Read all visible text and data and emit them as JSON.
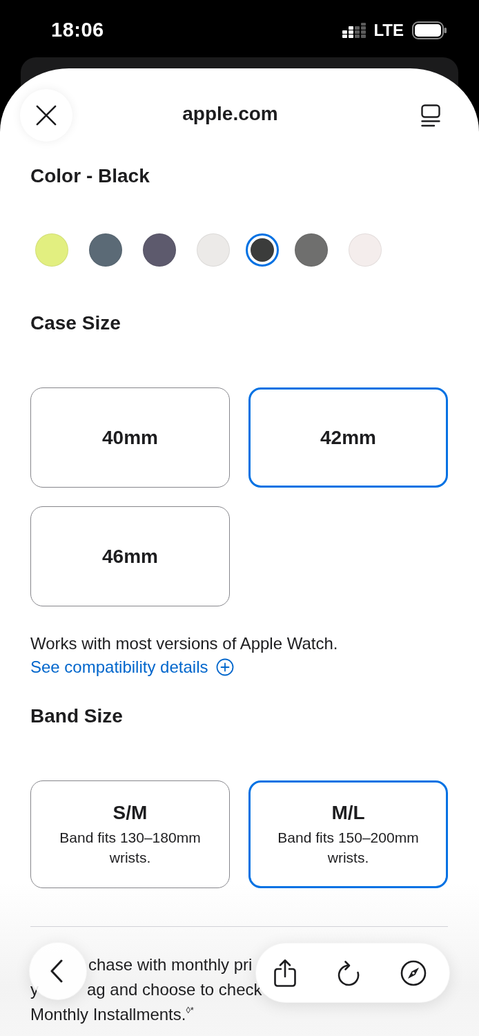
{
  "status_bar": {
    "time": "18:06",
    "network": "LTE"
  },
  "header": {
    "title": "apple.com"
  },
  "color_section": {
    "title": "Color - Black",
    "swatches": [
      {
        "color": "#e2ef80",
        "selected": false
      },
      {
        "color": "#5b6a76",
        "selected": false
      },
      {
        "color": "#5d5a6d",
        "selected": false
      },
      {
        "color": "#eceae8",
        "selected": false
      },
      {
        "color": "#3b3c3b",
        "selected": true
      },
      {
        "color": "#6f6f6e",
        "selected": false
      },
      {
        "color": "#f4edec",
        "selected": false
      }
    ]
  },
  "case_size": {
    "title": "Case Size",
    "options": [
      {
        "label": "40mm",
        "selected": false
      },
      {
        "label": "42mm",
        "selected": true
      },
      {
        "label": "46mm",
        "selected": false
      }
    ],
    "note": "Works with most versions of Apple Watch.",
    "link": "See compatibility details"
  },
  "band_size": {
    "title": "Band Size",
    "options": [
      {
        "label": "S/M",
        "description": "Band fits 130–180mm wrists.",
        "selected": false
      },
      {
        "label": "M/L",
        "description": "Band fits 150–200mm wrists.",
        "selected": true
      }
    ]
  },
  "footer_text": {
    "lines": [
      [
        "chase with monthly pri"
      ],
      [
        "y",
        "ag and choose to check"
      ],
      [
        "Monthly Installments.$^{◊*}$"
      ]
    ]
  }
}
